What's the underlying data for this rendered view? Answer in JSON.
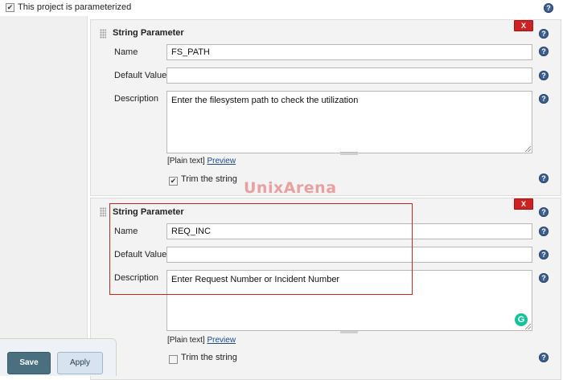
{
  "header": {
    "parameterized_label": "This project is parameterized",
    "parameterized_checked": true
  },
  "watermark": "UnixArena",
  "params": [
    {
      "title": "String Parameter",
      "delete_label": "X",
      "name_label": "Name",
      "name_value": "FS_PATH",
      "default_label": "Default Value",
      "default_value": "",
      "desc_label": "Description",
      "desc_value": "Enter the filesystem path to check the utilization",
      "format_prefix": "[Plain text]",
      "preview_link": "Preview",
      "trim_label": "Trim the string",
      "trim_checked": true
    },
    {
      "title": "String Parameter",
      "delete_label": "X",
      "name_label": "Name",
      "name_value": "REQ_INC",
      "default_label": "Default Value",
      "default_value": "",
      "desc_label": "Description",
      "desc_value": "Enter Request Number or Incident Number",
      "format_prefix": "[Plain text]",
      "preview_link": "Preview",
      "trim_label": "Trim the string",
      "trim_checked": false
    }
  ],
  "help_glyph": "?",
  "grammarly_glyph": "G",
  "footer": {
    "save_label": "Save",
    "apply_label": "Apply"
  },
  "colors": {
    "delete_red": "#cc2222",
    "help_blue": "#3d5f8f",
    "save_bg": "#4a6f7f",
    "apply_bg": "#d7e4ef",
    "highlight_red": "#cc2222"
  },
  "icons": [
    "help-icon",
    "drag-handle-icon",
    "checkbox-icon",
    "grammarly-icon"
  ]
}
